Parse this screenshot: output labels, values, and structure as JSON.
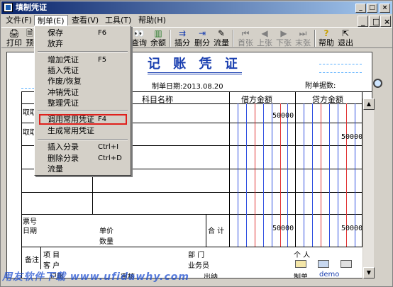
{
  "window": {
    "title": "填制凭证",
    "controls": [
      "_",
      "□",
      "×"
    ]
  },
  "menubar": {
    "items": [
      {
        "label": "文件(F)"
      },
      {
        "label": "制单(E)"
      },
      {
        "label": "查看(V)"
      },
      {
        "label": "工具(T)"
      },
      {
        "label": "帮助(H)"
      }
    ],
    "mdi_controls": [
      "_",
      "□",
      "×"
    ]
  },
  "toolbar": {
    "items": [
      {
        "label": "打印",
        "icon": "printer-icon",
        "glyph": "🖨"
      },
      {
        "label": "预",
        "icon": "preview-icon",
        "glyph": "🗎"
      },
      {
        "label": "查询",
        "icon": "binoculars-icon",
        "glyph": "👀"
      },
      {
        "label": "余额",
        "icon": "balance-chart-icon",
        "glyph": "▥"
      },
      {
        "label": "插分",
        "icon": "insert-split-icon",
        "glyph": "⇉"
      },
      {
        "label": "删分",
        "icon": "delete-split-icon",
        "glyph": "⇥"
      },
      {
        "label": "流量",
        "icon": "flow-icon",
        "glyph": "✎"
      },
      {
        "label": "首张",
        "icon": "first-icon",
        "glyph": "⏮"
      },
      {
        "label": "上张",
        "icon": "prev-icon",
        "glyph": "◀"
      },
      {
        "label": "下张",
        "icon": "next-icon",
        "glyph": "▶"
      },
      {
        "label": "末张",
        "icon": "last-icon",
        "glyph": "⏭"
      },
      {
        "label": "帮助",
        "icon": "help-icon",
        "glyph": "?"
      },
      {
        "label": "退出",
        "icon": "exit-icon",
        "glyph": "⇱"
      }
    ]
  },
  "menu": {
    "items": [
      {
        "label": "保存",
        "shortcut": "F6"
      },
      {
        "label": "放弃",
        "shortcut": ""
      },
      {
        "label": "增加凭证",
        "shortcut": "F5"
      },
      {
        "label": "插入凭证",
        "shortcut": ""
      },
      {
        "label": "作废/恢复",
        "shortcut": ""
      },
      {
        "label": "冲销凭证",
        "shortcut": ""
      },
      {
        "label": "整理凭证",
        "shortcut": ""
      },
      {
        "label": "调用常用凭证",
        "shortcut": "F4"
      },
      {
        "label": "生成常用凭证",
        "shortcut": ""
      },
      {
        "label": "插入分录",
        "shortcut": "Ctrl+I"
      },
      {
        "label": "删除分录",
        "shortcut": "Ctrl+D"
      },
      {
        "label": "流量",
        "shortcut": ""
      }
    ]
  },
  "voucher": {
    "title": "记 账 凭 证",
    "date_label": "制单日期:2013.08.20",
    "attach_label": "附单据数:",
    "col_subject": "科目名称",
    "col_debit": "借方金额",
    "col_credit": "贷方金额",
    "rows": [
      {
        "summary": "取取",
        "debit": "50000",
        "credit": ""
      },
      {
        "summary": "取取",
        "debit": "",
        "credit": "50000"
      }
    ],
    "ticket_no": "票号",
    "date": "日期",
    "unit_price": "单价",
    "quantity": "数量",
    "total_label": "合 计",
    "total_debit": "50000",
    "total_credit": "50000",
    "remark": "备注",
    "project": "项    目",
    "customer": "客    户",
    "department": "部    门",
    "salesperson": "业务员",
    "person": "个    人",
    "bookkeeper": "记账",
    "auditor": "审核",
    "cashier": "出纳",
    "preparer_label": "制单",
    "preparer": "demo"
  },
  "watermark": "用友软件下载 www.ufidawhy.com"
}
